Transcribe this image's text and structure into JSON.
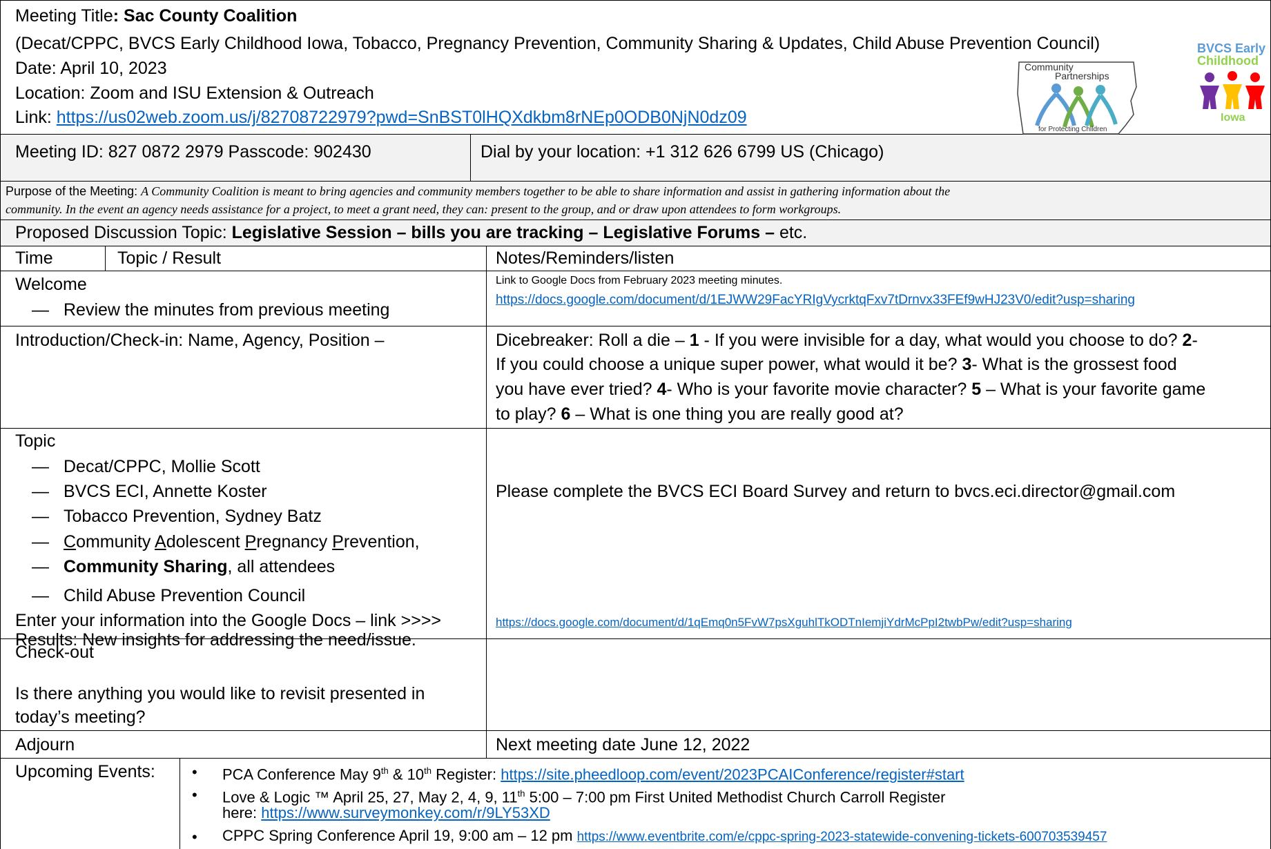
{
  "header": {
    "title_label": "Meeting Title",
    "title_value": ": Sac County Coalition",
    "groups": "(Decat/CPPC, BVCS Early Childhood Iowa, Tobacco, Pregnancy Prevention, Community Sharing & Updates, Child Abuse Prevention Council)",
    "date": "Date:  April 10, 2023",
    "location": "Location: Zoom and ISU Extension & Outreach",
    "link_label": "Link: ",
    "link_url": "https://us02web.zoom.us/j/82708722979?pwd=SnBST0lHQXdkbm8rNEp0ODB0NjN0dz09"
  },
  "logos": {
    "cp_line1": "Community",
    "cp_line2": "Partnerships",
    "cp_line3": "for Protecting Children",
    "bvcs_line1": "BVCS Early",
    "bvcs_line2": "Childhood",
    "bvcs_line3": "Iowa"
  },
  "meeting_info": {
    "id_label": "Meeting ID: ",
    "id_value": "827 0872 2979 Passcode: 902430",
    "dial_label": "Dial by your location: ",
    "dial_value": "+1 312 626 6799 US (Chicago)"
  },
  "purpose": {
    "label": "Purpose of the Meeting: ",
    "line1": "A Community Coalition is meant to bring agencies and community members together to be able to share information and assist in gathering information about the",
    "line2": "community.  In the event an agency needs assistance for a project, to meet a grant need, they can: present to the group, and or draw upon attendees to form workgroups."
  },
  "discussion": {
    "label": "Proposed Discussion Topic: ",
    "bold": "Legislative Session – bills you are tracking – Legislative Forums –",
    "tail": " etc."
  },
  "columns": {
    "time": "Time",
    "topic": "Topic / Result",
    "notes": "Notes/Reminders/listen"
  },
  "welcome": {
    "title": "Welcome",
    "item": "Review the minutes from previous meeting",
    "note": "Link to Google Docs from February 2023 meeting minutes.",
    "note_link": "https://docs.google.com/document/d/1EJWW29FacYRIgVycrktqFxv7tDrnvx33FEf9wHJ23V0/edit?usp=sharing"
  },
  "intro": {
    "title": "Introduction/Check-in: Name, Agency, Position –",
    "l1a": "Dicebreaker:  Roll a die – ",
    "n1": "1",
    "l1b": " - If you were invisible for a day, what would you choose to do? ",
    "n2": "2",
    "l1c": "-",
    "l2a": "If you could choose a unique super power, what would it be? ",
    "n3": "3",
    "l2b": "- What is the grossest food",
    "l3a": "you have ever tried? ",
    "n4": "4",
    "l3b": "- Who is your favorite movie character? ",
    "n5": "5",
    "l3c": " – What is your favorite game",
    "l4a": "to play? ",
    "n6": "6",
    "l4b": " – What is one thing you are really good at?"
  },
  "topic": {
    "title": "Topic",
    "items": [
      "Decat/CPPC, Mollie Scott",
      "BVCS ECI, Annette Koster",
      "Tobacco Prevention, Sydney Batz"
    ],
    "capp_c": "C",
    "capp_1": "ommunity ",
    "capp_a": "A",
    "capp_2": "dolescent ",
    "capp_p1": "P",
    "capp_3": "regnancy ",
    "capp_p2": "P",
    "capp_4": "revention,",
    "sharing_bold": "Community Sharing",
    "sharing_rest": ", all attendees",
    "capc": "Child Abuse Prevention Council",
    "enter": "Enter your information into the Google Docs – link >>>>",
    "results": " Results: New insights for addressing the need/issue.",
    "note": "Please complete the BVCS ECI Board Survey and return to bvcs.eci.director@gmail.com",
    "note_link": "https://docs.google.com/document/d/1qEmq0n5FvW7psXguhlTkODTnIemjiYdrMcPpI2twbPw/edit?usp=sharing"
  },
  "checkout": {
    "title": "Check-out",
    "line1": "Is there anything you would like to revisit presented in",
    "line2": "today’s meeting?"
  },
  "adjourn": {
    "title": "Adjourn",
    "note": "Next meeting date June 12, 2022"
  },
  "events": {
    "label": "Upcoming Events:",
    "e1_a": "PCA Conference May 9",
    "e1_th1": "th",
    "e1_b": " & 10",
    "e1_th2": "th",
    "e1_c": " Register:  ",
    "e1_link": "https://site.pheedloop.com/event/2023PCAIConference/register#start",
    "e2_a": "Love & Logic ™ April 25, 27, May 2, 4, 9, 11",
    "e2_th": "th",
    "e2_b": " 5:00 – 7:00 pm First United Methodist Church Carroll Register",
    "e2_c": "here: ",
    "e2_link": "https://www.surveymonkey.com/r/9LY53XD",
    "e3_a": "CPPC Spring Conference  April 19, 9:00 am – 12 pm ",
    "e3_link": "https://www.eventbrite.com/e/cppc-spring-2023-statewide-convening-tickets-600703539457"
  },
  "colors": {
    "link": "#0563c1",
    "grey": "#f2f2f2",
    "bvcs_blue": "#5b9bd5",
    "bvcs_green": "#92d050"
  }
}
